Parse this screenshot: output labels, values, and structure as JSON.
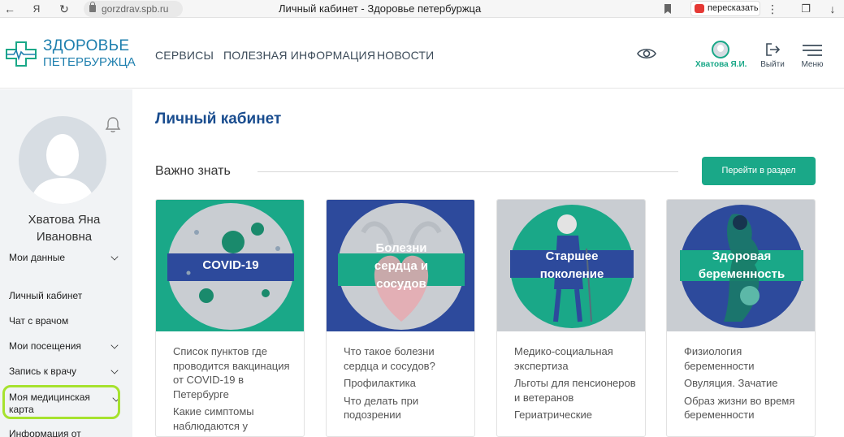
{
  "browser": {
    "url": "gorzdrav.spb.ru",
    "tab_title": "Личный кабинет - Здоровье петербуржца",
    "yandex_glyph": "Я",
    "retell_label": "пересказать"
  },
  "header": {
    "logo_line1": "ЗДОРОВЬЕ",
    "logo_line2": "ПЕТЕРБУРЖЦА",
    "nav": [
      "СЕРВИСЫ",
      "ПОЛЕЗНАЯ ИНФОРМАЦИЯ",
      "НОВОСТИ"
    ],
    "user_name": "Хватова Я.И.",
    "logout_label": "Выйти",
    "menu_label": "Меню"
  },
  "sidebar": {
    "full_name_line1": "Хватова Яна",
    "full_name_line2": "Ивановна",
    "items": [
      {
        "label": "Мои данные",
        "has_chevron": true
      },
      {
        "label": "Личный кабинет",
        "has_chevron": false
      },
      {
        "label": "Чат с врачом",
        "has_chevron": false
      },
      {
        "label": "Мои посещения",
        "has_chevron": true
      },
      {
        "label": "Запись к врачу",
        "has_chevron": true
      },
      {
        "label": "Моя медицинская карта",
        "has_chevron": true,
        "highlighted": true
      },
      {
        "label": "Информация от",
        "has_chevron": false
      }
    ]
  },
  "main": {
    "title": "Личный кабинет",
    "section_title": "Важно знать",
    "section_button": "Перейти в раздел",
    "cards": [
      {
        "title": "COVID-19",
        "links": [
          "Список пунктов где проводится вакцинация от COVID-19 в Петербурге",
          "Какие симптомы наблюдаются у"
        ]
      },
      {
        "title": "Болезни сердца и сосудов",
        "links": [
          "Что такое болезни сердца и сосудов?",
          "Профилактика",
          "Что делать при подозрении"
        ]
      },
      {
        "title": "Старшее поколение",
        "links": [
          "Медико-социальная экспертиза",
          "Льготы для пенсионеров и ветеранов",
          "Гериатрические"
        ]
      },
      {
        "title": "Здоровая беременность",
        "links": [
          "Физиология беременности",
          "Овуляция. Зачатие",
          "Образ жизни во время беременности"
        ]
      }
    ]
  },
  "colors": {
    "brand_green": "#1aa888",
    "brand_blue": "#1e7fae",
    "title_blue": "#1a4d8f",
    "card_blue": "#2d4a9c",
    "highlight": "#a6e22e"
  }
}
